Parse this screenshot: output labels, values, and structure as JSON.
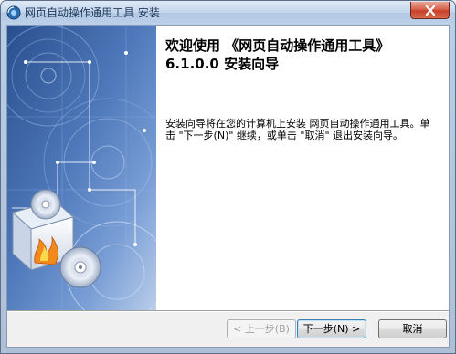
{
  "window": {
    "title": "网页自动操作通用工具 安装",
    "close_icon": "close-icon"
  },
  "content": {
    "heading_line1": "欢迎使用 《网页自动操作通用工具》",
    "heading_line2": "6.1.0.0 安装向导",
    "description": "安装向导将在您的计算机上安装 网页自动操作通用工具。单击 \"下一步(N)\" 继续，或单击 \"取消\" 退出安装向导。"
  },
  "buttons": {
    "back_label": "< 上一步(B)",
    "next_label": "下一步(N) >",
    "cancel_label": "取消"
  },
  "colors": {
    "side_panel_dark": "#1b3c7a",
    "side_panel_light": "#5b84c4",
    "close_button": "#c8402b"
  }
}
